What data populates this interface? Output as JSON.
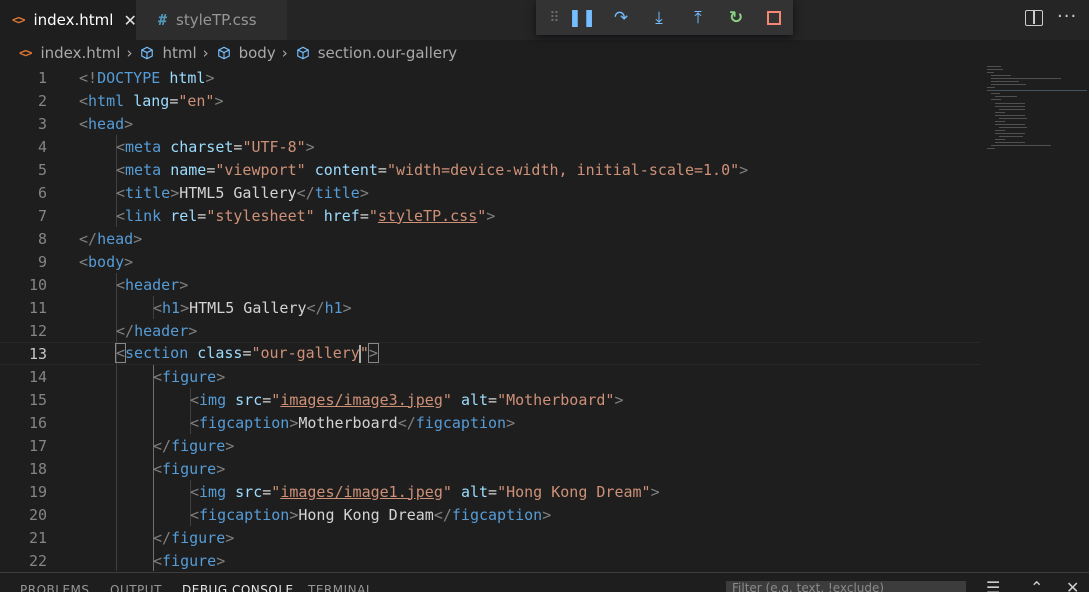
{
  "tabs": [
    {
      "label": "index.html",
      "icon": "html-file-icon",
      "active": true
    },
    {
      "label": "styleTP.css",
      "icon": "css-file-icon",
      "active": false
    }
  ],
  "tab_icons": {
    "html": "<>",
    "css": "#"
  },
  "debug_toolbar": [
    "drag-grip-icon",
    "pause-icon",
    "step-over-icon",
    "step-into-icon",
    "step-out-icon",
    "restart-icon",
    "stop-icon"
  ],
  "breadcrumb": [
    "index.html",
    "html",
    "body",
    "section.our-gallery"
  ],
  "editor": {
    "line_numbers": [
      "1",
      "2",
      "3",
      "4",
      "5",
      "6",
      "7",
      "8",
      "9",
      "10",
      "11",
      "12",
      "13",
      "14",
      "15",
      "16",
      "17",
      "18",
      "19",
      "20",
      "21",
      "22"
    ],
    "active_line": 13
  },
  "code": {
    "l1": {
      "open": "<!",
      "doctype": "DOCTYPE",
      "html": "html",
      "close": ">"
    },
    "l2": {
      "lt": "<",
      "tag": "html",
      "attr": "lang",
      "eq": "=",
      "val": "\"en\"",
      "gt": ">"
    },
    "l3": {
      "tag": "head"
    },
    "l4": {
      "tag": "meta",
      "attr": "charset",
      "val": "\"UTF-8\""
    },
    "l5": {
      "tag": "meta",
      "attr1": "name",
      "val1": "\"viewport\"",
      "attr2": "content",
      "val2": "\"width=device-width, initial-scale=1.0\""
    },
    "l6": {
      "tag": "title",
      "text": "HTML5 Gallery"
    },
    "l7": {
      "tag": "link",
      "attr1": "rel",
      "val1": "\"stylesheet\"",
      "attr2": "href",
      "val2_q1": "\"",
      "val2": "styleTP.css",
      "val2_q2": "\""
    },
    "l8": {
      "tag": "head"
    },
    "l9": {
      "tag": "body"
    },
    "l10": {
      "tag": "header"
    },
    "l11": {
      "tag": "h1",
      "text": "HTML5 Gallery"
    },
    "l12": {
      "tag": "header"
    },
    "l13": {
      "tag": "section",
      "attr": "class",
      "val": "\"our-gallery",
      "quote": "\""
    },
    "l14": {
      "tag": "figure"
    },
    "l15": {
      "tag": "img",
      "attr1": "src",
      "val1": "images/image3.jpeg",
      "attr2": "alt",
      "val2": "\"Motherboard\""
    },
    "l16": {
      "tag": "figcaption",
      "text": "Motherboard"
    },
    "l17": {
      "tag": "figure"
    },
    "l18": {
      "tag": "figure"
    },
    "l19": {
      "tag": "img",
      "attr1": "src",
      "val1": "images/image1.jpeg",
      "attr2": "alt",
      "val2": "\"Hong Kong Dream\""
    },
    "l20": {
      "tag": "figcaption",
      "text": "Hong Kong Dream"
    },
    "l21": {
      "tag": "figure"
    },
    "l22": {
      "tag": "figure"
    }
  },
  "panel": {
    "tabs": [
      "PROBLEMS",
      "OUTPUT",
      "DEBUG CONSOLE",
      "TERMINAL"
    ],
    "active": "DEBUG CONSOLE",
    "filter_placeholder": "Filter (e.g. text, !exclude)"
  },
  "colors": {
    "background": "#1e1e1e",
    "tag": "#569cd6",
    "attribute": "#9cdcfe",
    "string": "#ce9178",
    "punctuation": "#808080",
    "html_icon": "#e37933",
    "css_icon": "#519aba"
  }
}
